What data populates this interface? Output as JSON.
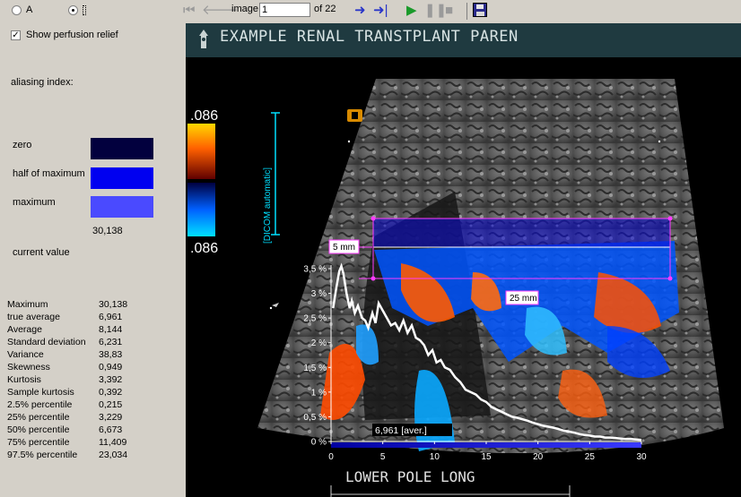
{
  "radio_options": [
    {
      "label": "A",
      "selected": false
    },
    {
      "label": "",
      "selected": true
    }
  ],
  "show_perfusion_relief": {
    "label": "Show perfusion relief",
    "checked": true
  },
  "aliasing_index_label": "aliasing index:",
  "levels": [
    {
      "label": "zero",
      "color": "#02003e"
    },
    {
      "label": "half of maximum",
      "color": "#0000f0"
    },
    {
      "label": "maximum",
      "color": "#4a4aff"
    }
  ],
  "current_value": {
    "value": "30,138",
    "label": "current value"
  },
  "statistics": [
    {
      "label": "Maximum",
      "value": "30,138"
    },
    {
      "label": "true average",
      "value": "6,961"
    },
    {
      "label": "Average",
      "value": "8,144"
    },
    {
      "label": "Standard deviation",
      "value": "6,231"
    },
    {
      "label": "Variance",
      "value": "38,83"
    },
    {
      "label": "Skewness",
      "value": "0,949"
    },
    {
      "label": "Kurtosis",
      "value": "3,392"
    },
    {
      "label": "Sample kurtosis",
      "value": "0,392"
    },
    {
      "label": "2.5% percentile",
      "value": "0,215"
    },
    {
      "label": "25% percentile",
      "value": "3,229"
    },
    {
      "label": "50% percentile",
      "value": "6,673"
    },
    {
      "label": "75% percentile",
      "value": "11,409"
    },
    {
      "label": "97.5% percentile",
      "value": "23,034"
    }
  ],
  "toolbar": {
    "image_label": "image",
    "image_value": "1",
    "of_label": "of 22"
  },
  "viewer": {
    "title": "EXAMPLE RENAL TRANSTPLANT PAREN",
    "scale_top": ".086",
    "scale_bottom": ".086",
    "dicom_label": "[DICOM automatic]",
    "roi_depth_label": "5 mm",
    "roi_width_label": "25 mm",
    "avg_label": "6,961 [aver.]",
    "bottom_label": "LOWER POLE LONG"
  },
  "chart_data": {
    "type": "line",
    "xlabel": "",
    "ylabel": "",
    "xlim": [
      0,
      30
    ],
    "ylim": [
      0,
      3.5
    ],
    "x_ticks": [
      "0",
      "5",
      "10",
      "15",
      "20",
      "25",
      "30"
    ],
    "y_ticks": [
      "0 %",
      "0,5 %",
      "1 %",
      "1,5 %",
      "2 %",
      "2,5 %",
      "3 %",
      "3,5 %"
    ],
    "series": [
      {
        "x": [
          0.2,
          0.5,
          0.8,
          1.0,
          1.2,
          1.5,
          1.8,
          2.0,
          2.3,
          2.6,
          3.0,
          3.3,
          3.6,
          4.0,
          4.3,
          4.6,
          5.0,
          5.4,
          5.8,
          6.2,
          6.6,
          7.0,
          7.4,
          7.8,
          8.2,
          8.6,
          9.0,
          9.4,
          9.8,
          10.2,
          10.6,
          11.0,
          11.5,
          12.0,
          12.5,
          13.0,
          13.5,
          14.0,
          14.5,
          15.0,
          15.5,
          16.0,
          16.5,
          17.0,
          17.5,
          18.0,
          18.5,
          19.0,
          19.5,
          20.0,
          20.5,
          21.0,
          21.5,
          22.0,
          22.5,
          23.0,
          23.5,
          24.0,
          24.5,
          25.0,
          25.5,
          26.0,
          26.5,
          27.0,
          27.5,
          28.0,
          28.5,
          29.0,
          29.5,
          30.0
        ],
        "y": [
          2.7,
          3.1,
          3.45,
          3.55,
          3.4,
          3.0,
          2.7,
          2.85,
          2.6,
          2.75,
          2.5,
          2.45,
          2.3,
          2.6,
          2.4,
          2.8,
          2.65,
          2.5,
          2.35,
          2.4,
          2.25,
          2.45,
          2.2,
          2.35,
          2.1,
          2.05,
          1.95,
          1.75,
          1.85,
          1.6,
          1.65,
          1.5,
          1.45,
          1.3,
          1.2,
          1.05,
          1.0,
          0.95,
          0.85,
          0.8,
          0.7,
          0.65,
          0.6,
          0.55,
          0.5,
          0.48,
          0.45,
          0.42,
          0.38,
          0.35,
          0.32,
          0.3,
          0.28,
          0.25,
          0.22,
          0.2,
          0.18,
          0.15,
          0.13,
          0.12,
          0.1,
          0.1,
          0.08,
          0.08,
          0.07,
          0.06,
          0.05,
          0.05,
          0.04,
          0.03
        ]
      }
    ]
  }
}
